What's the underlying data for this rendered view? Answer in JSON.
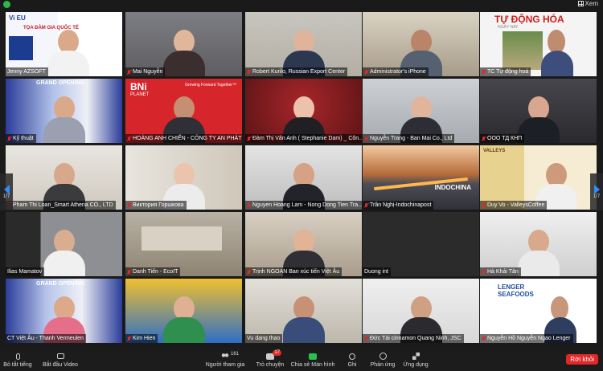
{
  "header": {
    "view_label": "Xem"
  },
  "pager": {
    "left": "1/7",
    "right": "1/7"
  },
  "colors": {
    "accent": "#2d8cff",
    "mute": "#e02828",
    "speaking": "#f3d23a",
    "share": "#27c24c"
  },
  "participants": [
    {
      "name": "Jenny AZSOFT"
    },
    {
      "name": "Mai Nguyễn"
    },
    {
      "name": "Robert Kurilo, Russian Export Center"
    },
    {
      "name": "Administrator's iPhone"
    },
    {
      "name": "TC Tự động hoá"
    },
    {
      "name": "Kỹ thuật"
    },
    {
      "name": "HOÀNG ANH CHIẾN - CÔNG TY AN PHÁT"
    },
    {
      "name": "Đàm Thị Vân Anh ( Stephanie Dam) _ Côn..."
    },
    {
      "name": "Nguyễn Trang - Ban Mai Co., Ltd"
    },
    {
      "name": "ООО ТД КНП"
    },
    {
      "name": "Pham Thi Loan_Smart Athena CO., LTD"
    },
    {
      "name": "Виктория Горшкова"
    },
    {
      "name": "Nguyen Hoang Lam - Nong Dong Tien Tra..."
    },
    {
      "name": "Trần Nghị-Indochinapost"
    },
    {
      "name": "Duy Vo - ValleysCoffee"
    },
    {
      "name": "Ilias Mamatov"
    },
    {
      "name": "Danh Tiến - EcoIT"
    },
    {
      "name": "Trịnh NGOAN Ban xúc tiến Việt Âu"
    },
    {
      "name": "Duong int"
    },
    {
      "name": "Hà Khải Tân"
    },
    {
      "name": "CT Việt Âu - Thanh Vermeulen"
    },
    {
      "name": "Kim Hien"
    },
    {
      "name": "Vu dang thao"
    },
    {
      "name": "Đức Tài cinnamon Quang Ninh, JSC"
    },
    {
      "name": "Nguyễn Hồ Nguyễn Ngao Lenger"
    }
  ],
  "tile_texts": {
    "tile0_banner": "TỌA ĐÀM GIA QUỐC TẾ",
    "tile0_logo": "Vi EU",
    "tile5_banner": "GRAND OPENING",
    "tile6_logo": "BNi",
    "tile6_sub": "PLANET",
    "tile6_tag": "Growing Forward Together™",
    "tile4_brand": "TỰ ĐỘNG HÓA",
    "tile4_sub": "NGÀY NAY",
    "tile13_brand": "INDOCHINA",
    "tile14_brand": "VALLEYS",
    "tile20_banner": "GRAND OPENING",
    "tile24_brand": "LENGER SEAFOODS"
  },
  "toolbar": {
    "mic_label": "Bỏ tắt tiếng",
    "video_label": "Bắt đầu Video",
    "participants_label": "Người tham gia",
    "participants_count": "161",
    "chat_label": "Trò chuyện",
    "chat_badge": "17",
    "share_label": "Chia sẻ Màn hình",
    "record_label": "Ghi",
    "reactions_label": "Phản ứng",
    "apps_label": "Ứng dụng",
    "leave_label": "Rời khỏi"
  }
}
